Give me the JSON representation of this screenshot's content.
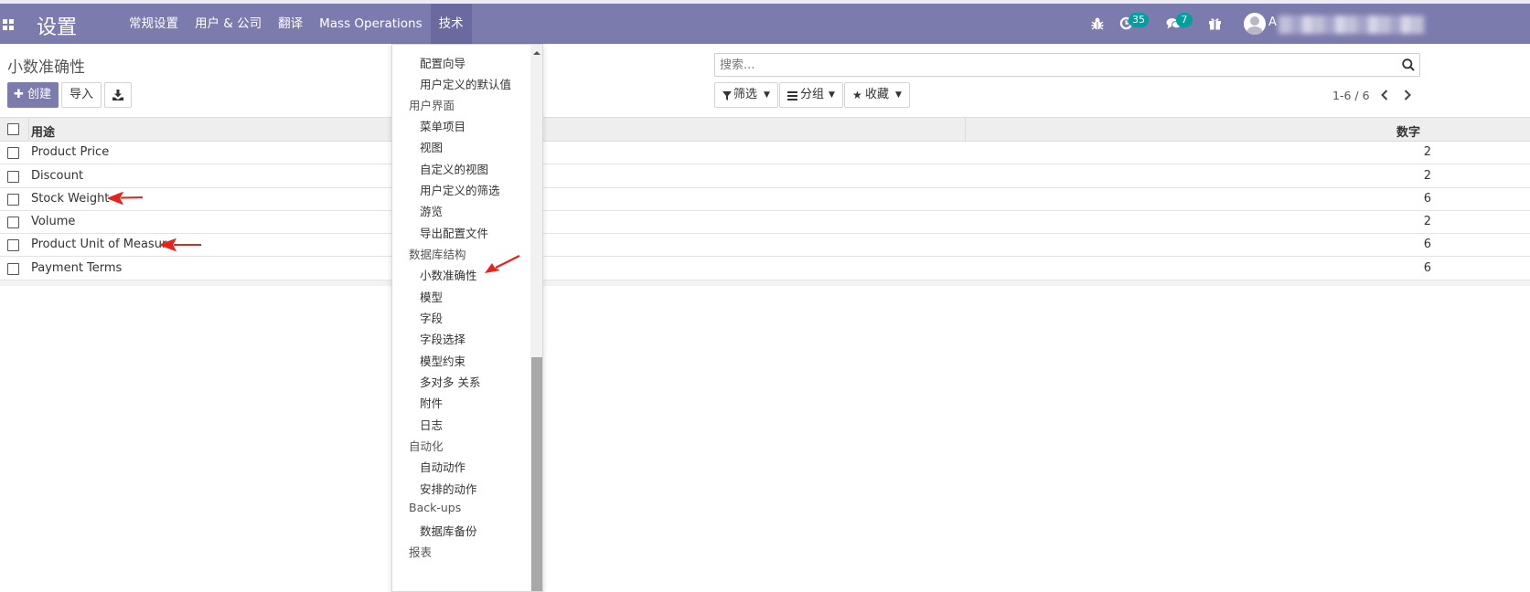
{
  "navbar": {
    "brand": "设置",
    "menu": [
      "常规设置",
      "用户 & 公司",
      "翻译",
      "Mass Operations",
      "技术"
    ],
    "active_menu": "技术",
    "activity_count": "35",
    "message_count": "7",
    "user_initial": "A"
  },
  "page": {
    "title": "小数准确性",
    "create_label": "创建",
    "import_label": "导入",
    "search_placeholder": "搜索...",
    "filter_label": "筛选",
    "groupby_label": "分组",
    "favorites_label": "收藏",
    "pager": "1-6 / 6"
  },
  "table": {
    "col_usage": "用途",
    "col_digits": "数字",
    "rows": [
      {
        "name": "Product Price",
        "digits": "2"
      },
      {
        "name": "Discount",
        "digits": "2"
      },
      {
        "name": "Stock Weight",
        "digits": "6"
      },
      {
        "name": "Volume",
        "digits": "2"
      },
      {
        "name": "Product Unit of Measure",
        "digits": "6"
      },
      {
        "name": "Payment Terms",
        "digits": "6"
      }
    ]
  },
  "dropdown": {
    "entries": [
      {
        "label": "配置向导",
        "kind": "item"
      },
      {
        "label": "用户定义的默认值",
        "kind": "item"
      },
      {
        "label": "用户界面",
        "kind": "header"
      },
      {
        "label": "菜单项目",
        "kind": "item"
      },
      {
        "label": "视图",
        "kind": "item"
      },
      {
        "label": "自定义的视图",
        "kind": "item"
      },
      {
        "label": "用户定义的筛选",
        "kind": "item"
      },
      {
        "label": "游览",
        "kind": "item"
      },
      {
        "label": "导出配置文件",
        "kind": "item"
      },
      {
        "label": "数据库结构",
        "kind": "header"
      },
      {
        "label": "小数准确性",
        "kind": "item"
      },
      {
        "label": "模型",
        "kind": "item"
      },
      {
        "label": "字段",
        "kind": "item"
      },
      {
        "label": "字段选择",
        "kind": "item"
      },
      {
        "label": "模型约束",
        "kind": "item"
      },
      {
        "label": "多对多 关系",
        "kind": "item"
      },
      {
        "label": "附件",
        "kind": "item"
      },
      {
        "label": "日志",
        "kind": "item"
      },
      {
        "label": "自动化",
        "kind": "header"
      },
      {
        "label": "自动动作",
        "kind": "item"
      },
      {
        "label": "安排的动作",
        "kind": "item"
      },
      {
        "label": "Back-ups",
        "kind": "header"
      },
      {
        "label": "数据库备份",
        "kind": "item"
      },
      {
        "label": "报表",
        "kind": "header"
      }
    ]
  },
  "colors": {
    "navbar": "#7c7bad",
    "badge": "#00a09d",
    "annotation_arrow": "#e8231f"
  }
}
